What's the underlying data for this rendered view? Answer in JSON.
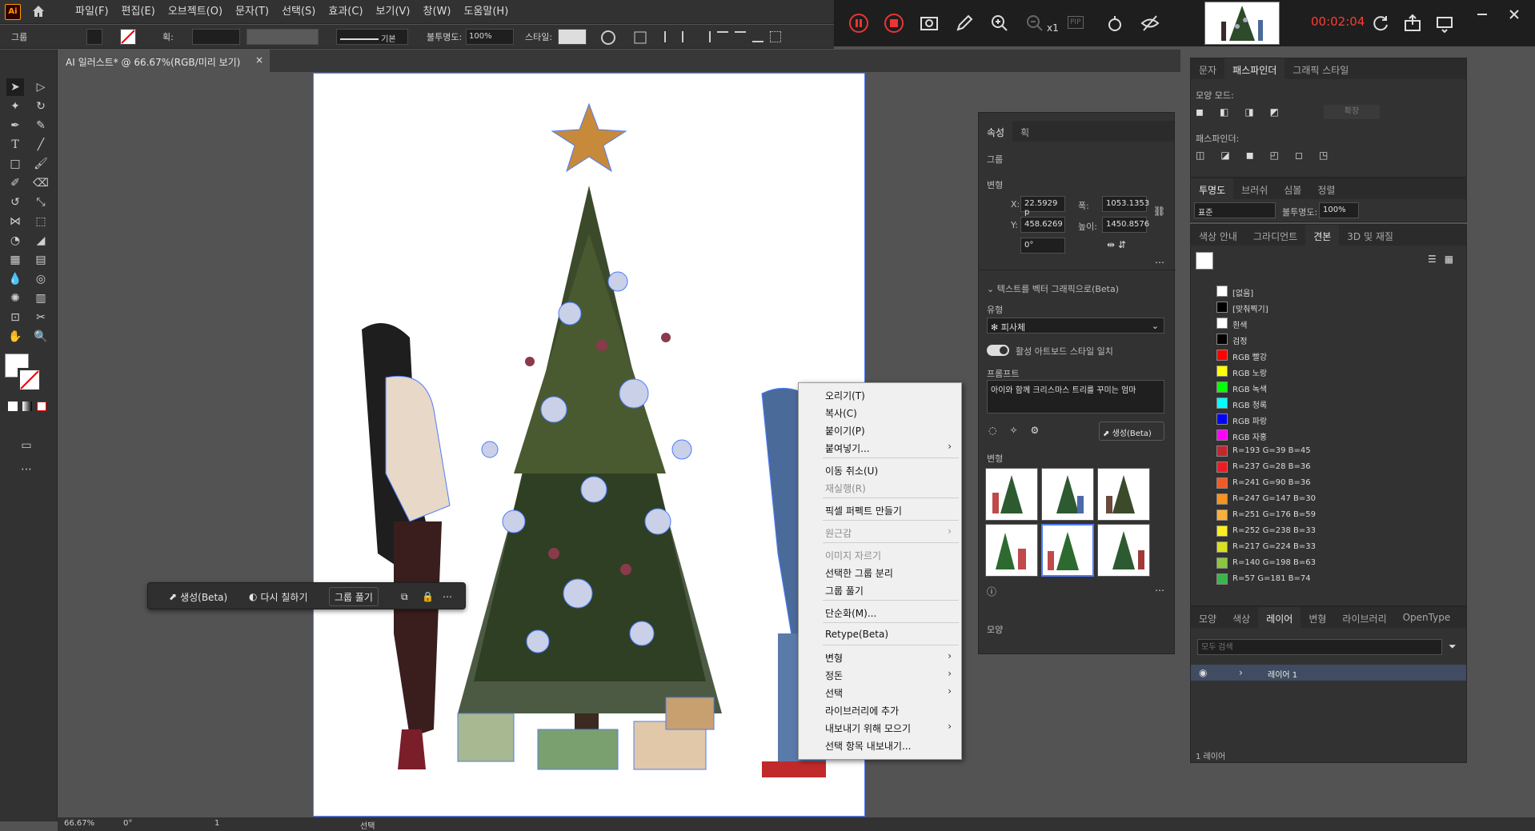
{
  "app": {
    "logo": "Ai"
  },
  "menu": [
    "파일(F)",
    "편집(E)",
    "오브젝트(O)",
    "문자(T)",
    "선택(S)",
    "효과(C)",
    "보기(V)",
    "창(W)",
    "도움말(H)"
  ],
  "recorder": {
    "timer": "00:02:04",
    "zoom_label": "x1",
    "pip": "PIP"
  },
  "controlbar": {
    "selection_label": "그룹",
    "stroke_label": "획:",
    "stroke_style": "기본",
    "opacity_label": "불투명도:",
    "opacity_value": "100%",
    "style_label": "스타일:"
  },
  "document": {
    "tab_title": "AI 일러스트* @ 66.67%(RGB/미리 보기)"
  },
  "status": {
    "zoom": "66.67%",
    "rotation": "0°",
    "artboard": "1",
    "tool": "선택"
  },
  "contextual_bar": {
    "generate": "생성(Beta)",
    "recolor": "다시 칠하기",
    "ungroup": "그룹 풀기"
  },
  "context_menu": {
    "items": [
      {
        "label": "오리기(T)",
        "disabled": false,
        "sub": false
      },
      {
        "label": "복사(C)",
        "disabled": false,
        "sub": false
      },
      {
        "label": "붙이기(P)",
        "disabled": false,
        "sub": false
      },
      {
        "label": "붙여넣기...",
        "disabled": false,
        "sub": true
      },
      {
        "label": "이동 취소(U)",
        "disabled": false,
        "sub": false
      },
      {
        "label": "재실행(R)",
        "disabled": true,
        "sub": false
      },
      {
        "label": "픽셀 퍼펙트 만들기",
        "disabled": false,
        "sub": false
      },
      {
        "label": "원근감",
        "disabled": true,
        "sub": true
      },
      {
        "label": "이미지 자르기",
        "disabled": true,
        "sub": false
      },
      {
        "label": "선택한 그룹 분리",
        "disabled": false,
        "sub": false
      },
      {
        "label": "그룹 풀기",
        "disabled": false,
        "sub": false
      },
      {
        "label": "단순화(M)...",
        "disabled": false,
        "sub": false
      },
      {
        "label": "Retype(Beta)",
        "disabled": false,
        "sub": false
      },
      {
        "label": "변형",
        "disabled": false,
        "sub": true
      },
      {
        "label": "정돈",
        "disabled": false,
        "sub": true
      },
      {
        "label": "선택",
        "disabled": false,
        "sub": true
      },
      {
        "label": "라이브러리에 추가",
        "disabled": false,
        "sub": false
      },
      {
        "label": "내보내기 위해 모으기",
        "disabled": false,
        "sub": true
      },
      {
        "label": "선택 항목 내보내기...",
        "disabled": false,
        "sub": false
      }
    ]
  },
  "properties": {
    "tabs": [
      "속성",
      "획"
    ],
    "group": "그룹",
    "transform": "변형",
    "x_label": "X:",
    "x": "22.5929 p",
    "y_label": "Y:",
    "y": "458.6269",
    "w_label": "폭:",
    "w": "1053.1353",
    "h_label": "높이:",
    "h": "1450.8576",
    "angle": "0°",
    "text_to_vector": "텍스트를 벡터 그래픽으로(Beta)",
    "type_label": "유형",
    "type_value": "피사체",
    "match_style": "활성 아트보드 스타일 일치",
    "prompt_label": "프롬프트",
    "prompt": "아이와 함께 크리스마스 트리를 꾸미는 엄마",
    "generate": "생성(Beta)",
    "variations": "변형",
    "appearance": "모양"
  },
  "pathfinder": {
    "tabs": [
      "문자",
      "패스파인더",
      "그래픽 스타일"
    ],
    "shape_modes": "모양 모드:",
    "expand": "확장",
    "pathfinders": "패스파인더:"
  },
  "transparency": {
    "tabs": [
      "투명도",
      "브러쉬",
      "심볼",
      "정렬"
    ],
    "mode": "표준",
    "opacity_label": "불투명도:",
    "opacity": "100%"
  },
  "swatches": {
    "tabs": [
      "색상 안내",
      "그라디언트",
      "견본",
      "3D 및 재질"
    ],
    "items": [
      {
        "name": "[없음]",
        "color": "#ffffff"
      },
      {
        "name": "[맞춰찍기]",
        "color": "#000000"
      },
      {
        "name": "흰색",
        "color": "#ffffff"
      },
      {
        "name": "검정",
        "color": "#000000"
      },
      {
        "name": "RGB 빨강",
        "color": "#ff0000"
      },
      {
        "name": "RGB 노랑",
        "color": "#ffff00"
      },
      {
        "name": "RGB 녹색",
        "color": "#00ff00"
      },
      {
        "name": "RGB 청록",
        "color": "#00ffff"
      },
      {
        "name": "RGB 파랑",
        "color": "#0000ff"
      },
      {
        "name": "RGB 자홍",
        "color": "#ff00ff"
      },
      {
        "name": "R=193 G=39 B=45",
        "color": "#c1272d"
      },
      {
        "name": "R=237 G=28 B=36",
        "color": "#ed1c24"
      },
      {
        "name": "R=241 G=90 B=36",
        "color": "#f15a24"
      },
      {
        "name": "R=247 G=147 B=30",
        "color": "#f7931e"
      },
      {
        "name": "R=251 G=176 B=59",
        "color": "#fbb03b"
      },
      {
        "name": "R=252 G=238 B=33",
        "color": "#fcee21"
      },
      {
        "name": "R=217 G=224 B=33",
        "color": "#d9e021"
      },
      {
        "name": "R=140 G=198 B=63",
        "color": "#8cc63f"
      },
      {
        "name": "R=57 G=181 B=74",
        "color": "#39b54a"
      }
    ]
  },
  "layers": {
    "tabs": [
      "모양",
      "색상",
      "레이어",
      "변형",
      "라이브러리",
      "OpenType"
    ],
    "search_placeholder": "모두 검색",
    "layer_name": "레이어 1",
    "count": "1 레이어"
  }
}
